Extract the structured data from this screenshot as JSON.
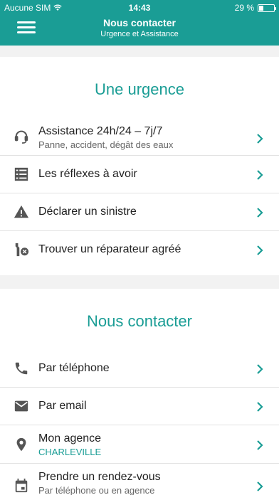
{
  "status_bar": {
    "carrier": "Aucune SIM",
    "time": "14:43",
    "battery": "29 %",
    "battery_level": 0.29
  },
  "header": {
    "title": "Nous contacter",
    "subtitle": "Urgence et Assistance",
    "menu_icon": "hamburger-menu-icon"
  },
  "urgence": {
    "title": "Une urgence",
    "items": [
      {
        "label": "Assistance 24h/24 – 7j/7",
        "sub": "Panne, accident, dégât des eaux",
        "icon": "headset-icon"
      },
      {
        "label": "Les réflexes à avoir",
        "icon": "checklist-icon"
      },
      {
        "label": "Déclarer un sinistre",
        "icon": "warning-icon"
      },
      {
        "label": "Trouver un réparateur agréé",
        "icon": "wrench-icon"
      }
    ]
  },
  "contact": {
    "title": "Nous contacter",
    "items": [
      {
        "label": "Par téléphone",
        "icon": "phone-icon"
      },
      {
        "label": "Par email",
        "icon": "email-icon"
      },
      {
        "label": "Mon agence",
        "sub": "CHARLEVILLE",
        "icon": "location-pin-icon"
      },
      {
        "label": "Prendre un rendez-vous",
        "sub": "Par téléphone ou en agence",
        "icon": "calendar-icon"
      }
    ]
  },
  "colors": {
    "accent": "#1a9d95",
    "text": "#222222",
    "muted": "#666666",
    "divider": "#e2e2e2"
  }
}
